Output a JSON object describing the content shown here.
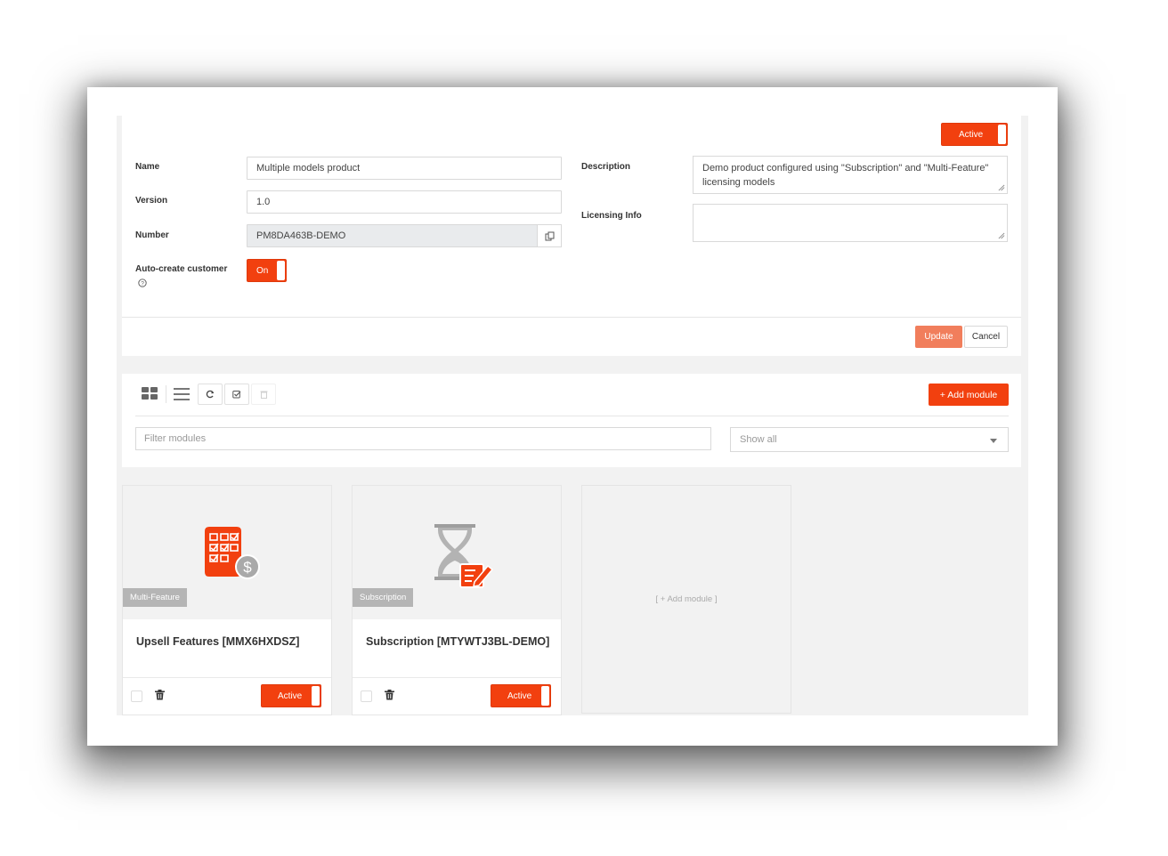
{
  "product": {
    "status_label": "Active",
    "name_label": "Name",
    "name_value": "Multiple models product",
    "version_label": "Version",
    "version_value": "1.0",
    "number_label": "Number",
    "number_value": "PM8DA463B-DEMO",
    "autocreate_label": "Auto-create customer",
    "autocreate_value": "On",
    "description_label": "Description",
    "description_value": "Demo product configured using \"Subscription\" and \"Multi-Feature\" licensing models",
    "licensing_label": "Licensing Info",
    "licensing_value": "",
    "update_label": "Update",
    "cancel_label": "Cancel"
  },
  "toolbar": {
    "add_module_label": "+ Add module",
    "filter_placeholder": "Filter modules",
    "show_select_value": "Show all"
  },
  "modules": [
    {
      "tag": "Multi-Feature",
      "title": "Upsell Features [MMX6HXDSZ]",
      "status": "Active",
      "icon": "checklist-dollar-icon"
    },
    {
      "tag": "Subscription",
      "title": "Subscription [MTYWTJ3BL-DEMO]",
      "status": "Active",
      "icon": "hourglass-document-icon"
    }
  ],
  "add_module_card_label": "[ + Add module ]",
  "colors": {
    "accent": "#f2400f",
    "update_button": "#f17e5c",
    "tag_bg": "#b5b5b5"
  }
}
